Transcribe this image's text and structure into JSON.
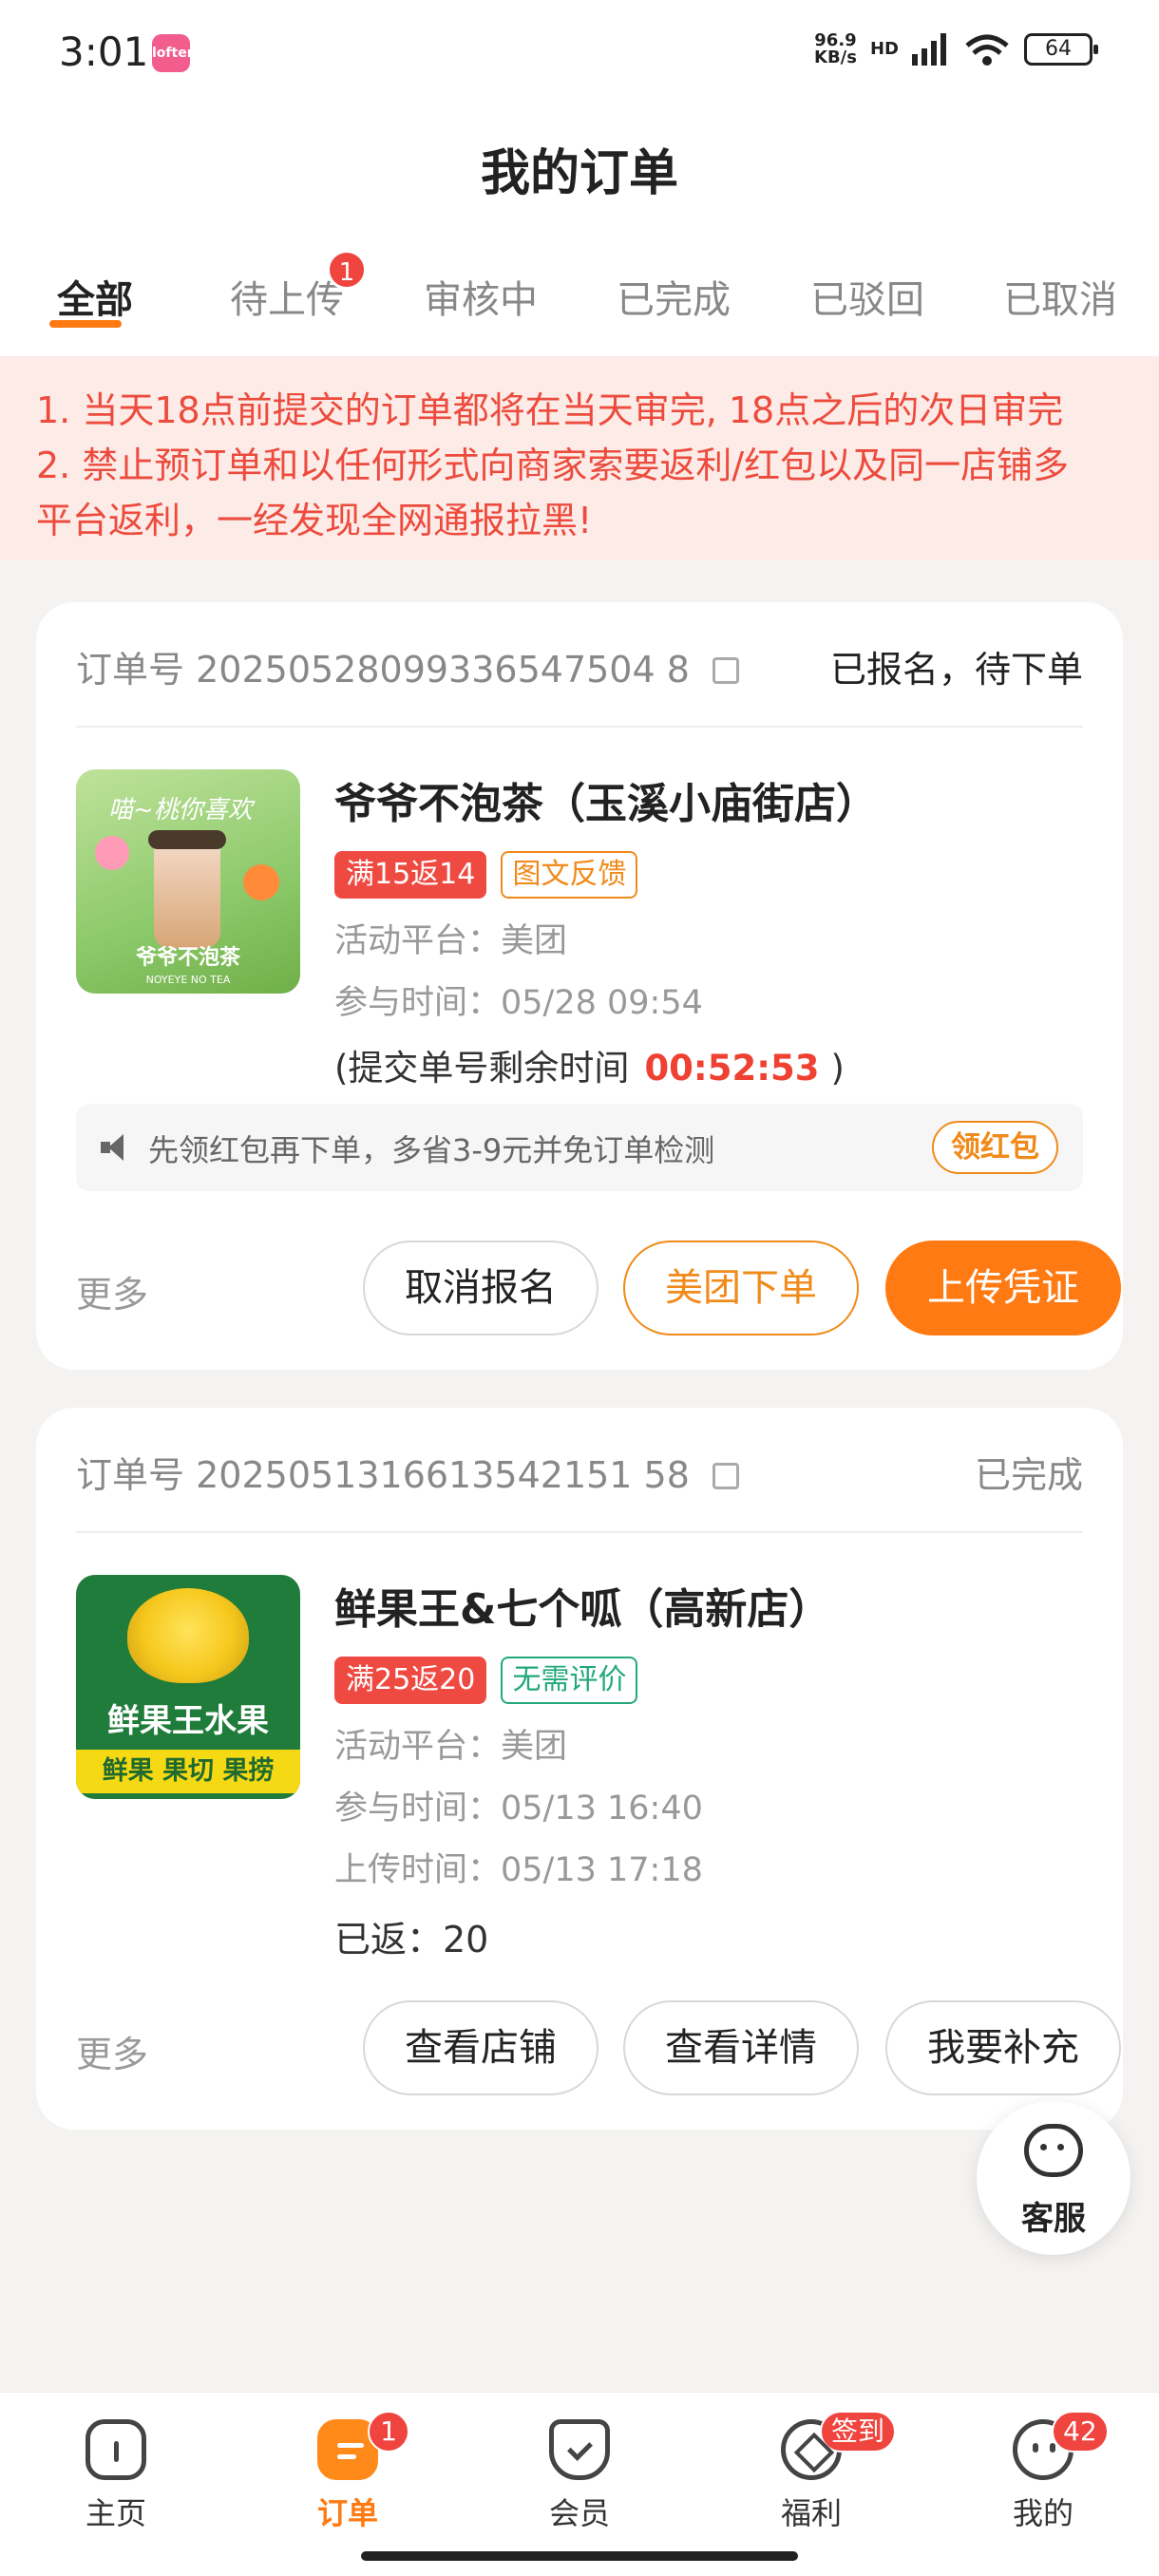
{
  "status_bar": {
    "time": "3:01",
    "app_icon_text": "lofter",
    "network_speed_value": "96.9",
    "network_speed_unit": "KB/s",
    "network_type": "HD",
    "battery": "64"
  },
  "header": {
    "title": "我的订单"
  },
  "tabs": [
    {
      "label": "全部",
      "active": true
    },
    {
      "label": "待上传",
      "badge": "1"
    },
    {
      "label": "审核中"
    },
    {
      "label": "已完成"
    },
    {
      "label": "已驳回"
    },
    {
      "label": "已取消"
    }
  ],
  "notice": {
    "line1": "1. 当天18点前提交的订单都将在当天审完, 18点之后的次日审完",
    "line2": "2. 禁止预订单和以任何形式向商家索要返利/红包以及同一店铺多",
    "line3": "平台返利，一经发现全网通报拉黑!"
  },
  "orders": [
    {
      "order_label": "订单号",
      "order_no": "20250528099336547504 8",
      "status": "已报名，待下单",
      "thumb_text": "喵~桃你喜欢",
      "thumb_brand": "爷爷不泡茶",
      "thumb_brand_en": "NOYEYE NO TEA",
      "shop_name": "爷爷不泡茶（玉溪小庙街店）",
      "tags": [
        "满15返14",
        "图文反馈"
      ],
      "platform": "活动平台：美团",
      "join_time": "参与时间：05/28 09:54",
      "countdown_prefix": "(提交单号剩余时间",
      "countdown": "00:52:53",
      "countdown_suffix": ")",
      "tip_text": "先领红包再下单，多省3-9元并免订单检测",
      "tip_button": "领红包",
      "more": "更多",
      "buttons": [
        "取消报名",
        "美团下单",
        "上传凭证"
      ]
    },
    {
      "order_label": "订单号",
      "order_no": "2025051316613542151 58",
      "status": "已完成",
      "thumb_text": "鲜果王水果",
      "thumb_band": "鲜果 果切 果捞",
      "shop_name": "鲜果王&七个呱（高新店）",
      "tags": [
        "满25返20",
        "无需评价"
      ],
      "platform": "活动平台：美团",
      "join_time": "参与时间：05/13 16:40",
      "upload_time": "上传时间：05/13 17:18",
      "returned": "已返：20",
      "more": "更多",
      "buttons": [
        "查看店铺",
        "查看详情",
        "我要补充"
      ]
    }
  ],
  "customer_service": {
    "label": "客服"
  },
  "bottom_nav": [
    {
      "label": "主页",
      "icon": "home-icon"
    },
    {
      "label": "订单",
      "icon": "order-icon",
      "active": true,
      "badge": "1"
    },
    {
      "label": "会员",
      "icon": "member-icon"
    },
    {
      "label": "福利",
      "icon": "welfare-icon",
      "badge": "签到"
    },
    {
      "label": "我的",
      "icon": "mine-icon",
      "badge": "42"
    }
  ],
  "colors": {
    "accent": "#ff7a12",
    "danger": "#ee4132",
    "background": "#f4f3f2"
  }
}
